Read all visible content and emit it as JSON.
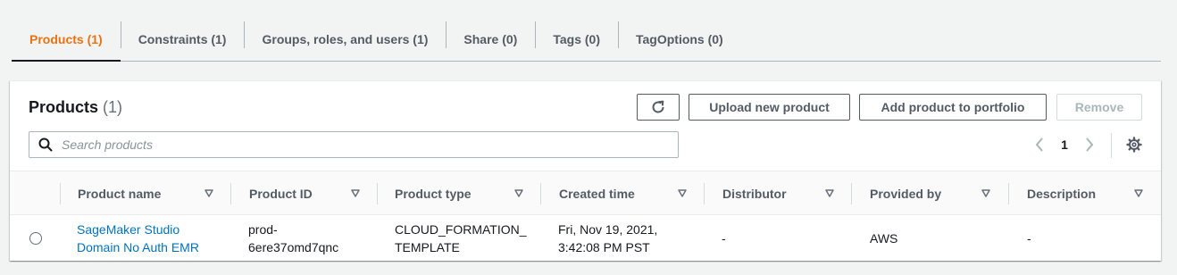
{
  "tabs": [
    {
      "label": "Products (1)",
      "active": true
    },
    {
      "label": "Constraints (1)",
      "active": false
    },
    {
      "label": "Groups, roles, and users (1)",
      "active": false
    },
    {
      "label": "Share (0)",
      "active": false
    },
    {
      "label": "Tags (0)",
      "active": false
    },
    {
      "label": "TagOptions (0)",
      "active": false
    }
  ],
  "panel": {
    "title": "Products",
    "count": "(1)",
    "refresh_icon": "refresh-icon",
    "upload_label": "Upload new product",
    "add_label": "Add product to portfolio",
    "remove_label": "Remove",
    "remove_disabled": true
  },
  "search": {
    "placeholder": "Search products",
    "value": "",
    "icon": "search-icon"
  },
  "pagination": {
    "current_page": "1",
    "prev_icon": "chevron-left-icon",
    "next_icon": "chevron-right-icon",
    "settings_icon": "gear-icon"
  },
  "table": {
    "columns": [
      "Product name",
      "Product ID",
      "Product type",
      "Created time",
      "Distributor",
      "Provided by",
      "Description"
    ],
    "rows": [
      {
        "selected": false,
        "name_line1": "SageMaker Studio",
        "name_line2": "Domain No Auth EMR",
        "id_line1": "prod-",
        "id_line2": "6ere37omd7qnc",
        "type_line1": "CLOUD_FORMATION_",
        "type_line2": "TEMPLATE",
        "created_line1": "Fri, Nov 19, 2021,",
        "created_line2": "3:42:08 PM PST",
        "distributor": "-",
        "provided_by": "AWS",
        "description": "-"
      }
    ]
  },
  "colors": {
    "accent": "#ec7211",
    "link": "#0073bb",
    "text": "#16191f",
    "muted": "#545b64"
  }
}
